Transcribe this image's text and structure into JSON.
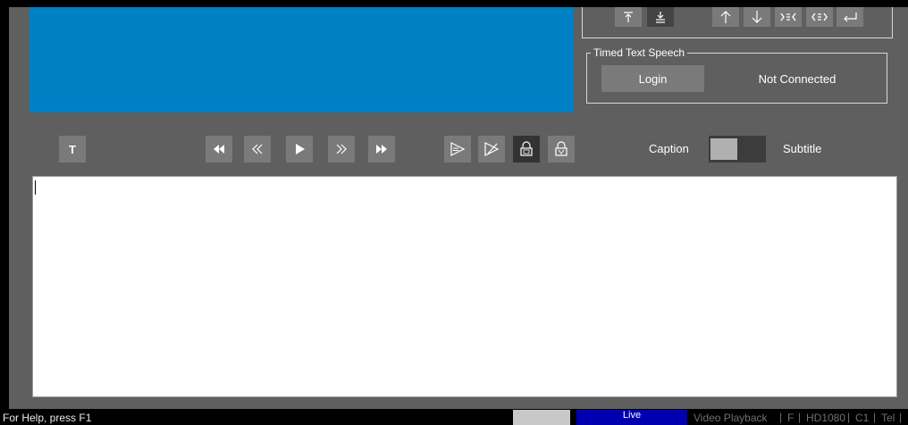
{
  "tts": {
    "title": "Timed Text Speech",
    "login_label": "Login",
    "status": "Not Connected"
  },
  "toolbar": {
    "text_button": "T",
    "caption_label": "Caption",
    "subtitle_label": "Subtitle",
    "mode_toggle": "caption"
  },
  "statusbar": {
    "help": "For Help, press F1",
    "live": "Live",
    "video_playback": "Video Playback",
    "f": "F",
    "format": "HD1080",
    "c1": "C1",
    "tel": "Tel"
  },
  "icons": {
    "nav": [
      "align-top-icon",
      "align-bottom-icon",
      "arrow-up-icon",
      "arrow-down-icon",
      "indent-in-icon",
      "indent-out-icon",
      "return-icon"
    ],
    "toolbar": [
      "text-icon",
      "rewind-fast-icon",
      "rewind-icon",
      "play-icon",
      "forward-icon",
      "forward-fast-icon",
      "send-caption-icon",
      "clear-caption-icon",
      "lock-caption-icon",
      "lock-video-icon"
    ]
  },
  "colors": {
    "background": "#5f5f5f",
    "video": "#0080c4",
    "button": "#7a7a7a",
    "live": "#0000b0"
  }
}
